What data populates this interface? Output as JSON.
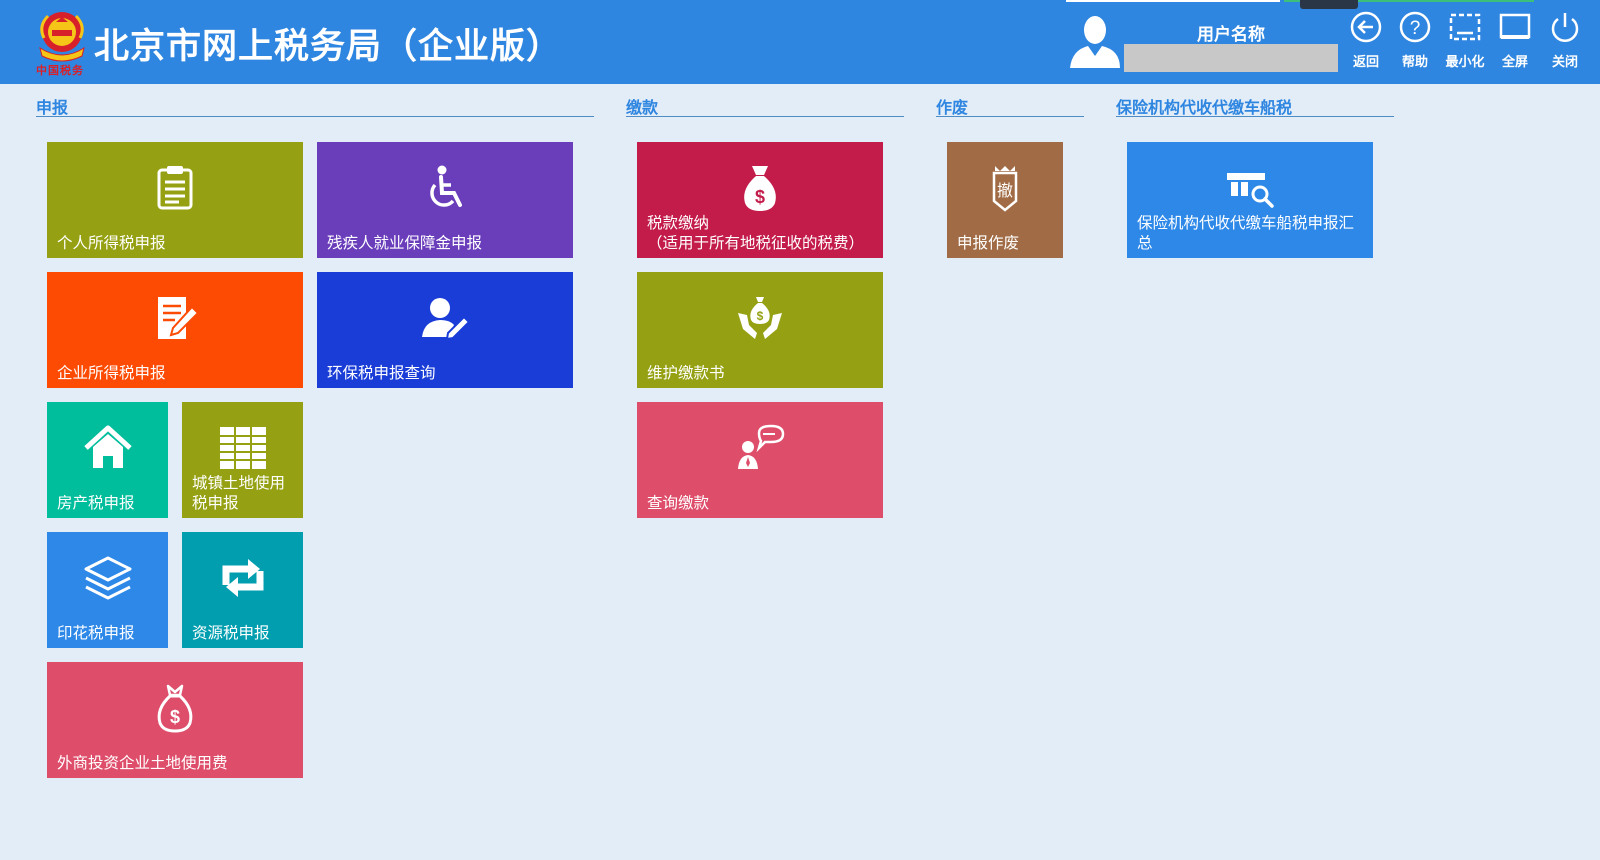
{
  "header": {
    "title": "北京市网上税务局（企业版）",
    "emblem_text": "中国税务",
    "user_label": "用户名称",
    "buttons": [
      {
        "icon": "back-circle-icon",
        "label": "返回"
      },
      {
        "icon": "help-circle-icon",
        "label": "帮助"
      },
      {
        "icon": "minimize-icon",
        "label": "最小化"
      },
      {
        "icon": "fullscreen-icon",
        "label": "全屏"
      },
      {
        "icon": "power-icon",
        "label": "关闭"
      }
    ]
  },
  "sections": {
    "declare": "申报",
    "payment": "缴款",
    "void": "作废",
    "insurance": "保险机构代收代缴车船税"
  },
  "tiles": {
    "personal_income_tax": {
      "label": "个人所得税申报",
      "icon": "clipboard-icon",
      "color": "#95a112"
    },
    "disabled_employment": {
      "label": "残疾人就业保障金申报",
      "icon": "wheelchair-icon",
      "color": "#6a3dbb"
    },
    "corporate_income_tax": {
      "label": "企业所得税申报",
      "icon": "document-edit-icon",
      "color": "#fd4b04"
    },
    "env_tax_query": {
      "label": "环保税申报查询",
      "icon": "user-edit-icon",
      "color": "#1a3dd8"
    },
    "property_tax": {
      "label": "房产税申报",
      "icon": "house-icon",
      "color": "#00bd9c"
    },
    "urban_land_tax": {
      "label": "城镇土地使用税申报",
      "icon": "ledger-icon",
      "color": "#95a112"
    },
    "stamp_tax": {
      "label": "印花税申报",
      "icon": "layers-icon",
      "color": "#2d88e8"
    },
    "resource_tax": {
      "label": "资源税申报",
      "icon": "exchange-arrows-icon",
      "color": "#009eaf"
    },
    "foreign_land_fee": {
      "label": "外商投资企业土地使用费",
      "icon": "money-bag-outline-icon",
      "color": "#de4e6b"
    },
    "tax_payment": {
      "label_line1": "税款缴纳",
      "label_line2": "（适用于所有地税征收的税费）",
      "icon": "money-bag-icon",
      "color": "#c31c4b"
    },
    "maintain_payment_book": {
      "label": "维护缴款书",
      "icon": "hands-money-icon",
      "color": "#95a112"
    },
    "query_payment": {
      "label": "查询缴款",
      "icon": "user-speech-icon",
      "color": "#de4e6b"
    },
    "void_declaration": {
      "label": "申报作废",
      "icon": "void-badge-icon",
      "badge_text": "撤",
      "color": "#a16c45"
    },
    "vehicle_tax_summary": {
      "label": "保险机构代收代缴车船税申报汇总",
      "icon": "table-search-icon",
      "color": "#2d88e8"
    }
  }
}
